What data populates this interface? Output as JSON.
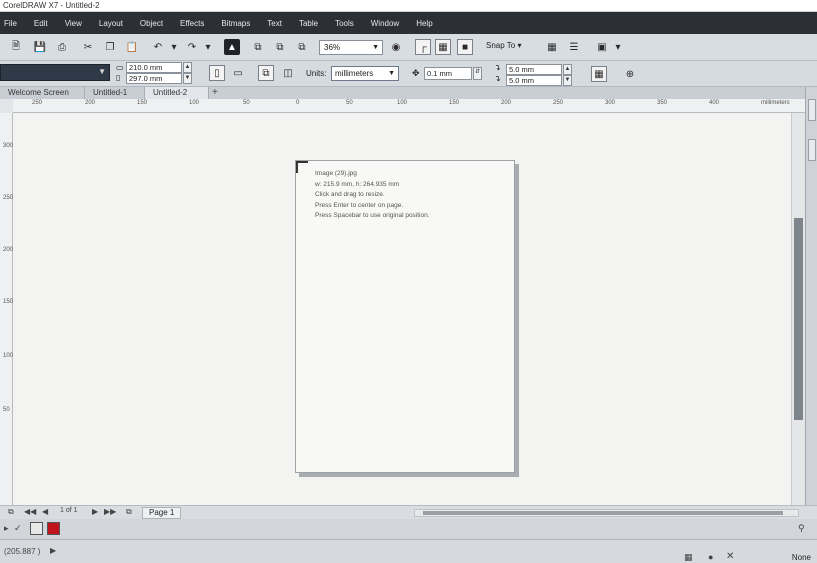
{
  "window": {
    "title": "CorelDRAW X7 - Untitled-2"
  },
  "menu": {
    "items": [
      "File",
      "Edit",
      "View",
      "Layout",
      "Object",
      "Effects",
      "Bitmaps",
      "Text",
      "Table",
      "Tools",
      "Window",
      "Help"
    ]
  },
  "toolbar": {
    "zoom_value": "36%",
    "snap_to_label": "Snap To"
  },
  "property_bar": {
    "page_width": "210.0 mm",
    "page_height": "297.0 mm",
    "units_label": "Units:",
    "units_value": "millimeters",
    "nudge_value": "0.1 mm",
    "dup_x": "5.0 mm",
    "dup_y": "5.0 mm"
  },
  "tabs": [
    {
      "label": "Welcome Screen",
      "active": false
    },
    {
      "label": "Untitled-1",
      "active": false
    },
    {
      "label": "Untitled-2",
      "active": true
    }
  ],
  "ruler": {
    "h_labels": [
      "250",
      "200",
      "150",
      "100",
      "50",
      "0",
      "50",
      "100",
      "150",
      "200",
      "250",
      "300",
      "350",
      "400",
      "millimeters"
    ],
    "v_labels": [
      "300",
      "250",
      "200",
      "150",
      "100",
      "50"
    ]
  },
  "tooltip": {
    "lines": [
      "Image (29).jpg",
      "w: 215.9 mm, h: 264.935 mm",
      "Click and drag to resize.",
      "Press Enter to center on page.",
      "Press Spacebar to use original position."
    ]
  },
  "page_navigator": {
    "page_label": "Page 1",
    "page_count": "1 of 1"
  },
  "status_bar": {
    "coords": "(205.887 )",
    "fill_label": "None"
  },
  "colors": {
    "menu_bg": "#2c2f34",
    "palette_red": "#c0141c"
  }
}
